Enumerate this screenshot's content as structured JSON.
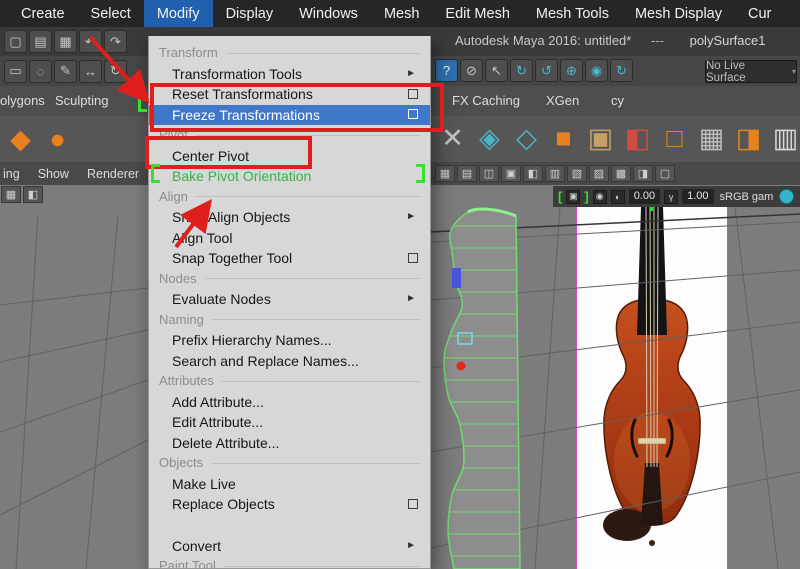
{
  "menubar": {
    "items": [
      {
        "label": "Create"
      },
      {
        "label": "Select"
      },
      {
        "label": "Modify",
        "active": true
      },
      {
        "label": "Display"
      },
      {
        "label": "Windows"
      },
      {
        "label": "Mesh"
      },
      {
        "label": "Edit Mesh"
      },
      {
        "label": "Mesh Tools"
      },
      {
        "label": "Mesh Display"
      },
      {
        "label": "Cur"
      }
    ]
  },
  "titlebar": {
    "title": "Autodesk Maya 2016: untitled*",
    "dashes": "---",
    "selection": "polySurface1"
  },
  "statusline": {
    "live_surface": "No Live Surface"
  },
  "quick_icons": [
    {
      "name": "new-scene-icon",
      "glyph": "▢"
    },
    {
      "name": "open-scene-icon",
      "glyph": "▤"
    },
    {
      "name": "save-scene-icon",
      "glyph": "▦"
    },
    {
      "name": "undo-icon",
      "glyph": "↶"
    },
    {
      "name": "redo-icon",
      "glyph": "↷"
    }
  ],
  "status_icons_left": [
    {
      "name": "select-tool-icon",
      "glyph": "▭"
    },
    {
      "name": "lasso-tool-icon",
      "glyph": "◌"
    },
    {
      "name": "paint-select-tool-icon",
      "glyph": "✎"
    },
    {
      "name": "move-tool-icon",
      "glyph": "↔"
    },
    {
      "name": "rotate-tool-icon",
      "glyph": "↻"
    }
  ],
  "status_icons_right": [
    {
      "name": "help-icon",
      "glyph": "?",
      "fg": "#e8f1fb",
      "bg": "#2f6fae"
    },
    {
      "name": "lock-selection-icon",
      "glyph": "⊘"
    },
    {
      "name": "highlight-selection-icon",
      "glyph": "↖"
    },
    {
      "name": "snap-grid-icon",
      "glyph": "↻",
      "fg": "#49b8cc"
    },
    {
      "name": "snap-curve-icon",
      "glyph": "↺",
      "fg": "#49b8cc"
    },
    {
      "name": "snap-point-icon",
      "glyph": "⊕",
      "fg": "#49b8cc"
    },
    {
      "name": "snap-plane-icon",
      "glyph": "◉",
      "fg": "#49b8cc"
    },
    {
      "name": "construction-history-icon",
      "glyph": "↻",
      "fg": "#49b8cc"
    }
  ],
  "shelf": {
    "tabs": [
      "olygons",
      "Sculpting",
      "FX Caching",
      "XGen",
      "cy"
    ]
  },
  "shelf_icons_left": [
    {
      "name": "poly-primitive-icon",
      "glyph": "◆",
      "fg": "#e8821e"
    },
    {
      "name": "poly-sphere-icon",
      "glyph": "●",
      "fg": "#e8821e"
    }
  ],
  "shelf_icons_right": [
    {
      "name": "multi-cut-icon",
      "glyph": "✕",
      "fg": "#c0c0c0"
    },
    {
      "name": "bevel-icon",
      "glyph": "◈",
      "fg": "#4ab6c8"
    },
    {
      "name": "bridge-icon",
      "glyph": "◇",
      "fg": "#4ab6c8"
    },
    {
      "name": "extrude-icon",
      "glyph": "■",
      "fg": "#e8821e"
    },
    {
      "name": "boolean-union-icon",
      "glyph": "▣",
      "fg": "#c8a06a"
    },
    {
      "name": "boolean-difference-icon",
      "glyph": "◧",
      "fg": "#d24b3f"
    },
    {
      "name": "combine-icon",
      "glyph": "□",
      "fg": "#e8821e"
    },
    {
      "name": "separate-icon",
      "glyph": "▦",
      "fg": "#bdbdbd"
    },
    {
      "name": "smooth-icon",
      "glyph": "◨",
      "fg": "#e8821e"
    },
    {
      "name": "mirror-icon",
      "glyph": "▥",
      "fg": "#d8d8d8"
    }
  ],
  "panel_toolbar": {
    "labels": [
      "ing",
      "Show",
      "Renderer"
    ]
  },
  "panel_icons": [
    {
      "name": "select-camera-icon",
      "glyph": "▦"
    },
    {
      "name": "lock-camera-icon",
      "glyph": "▤"
    },
    {
      "name": "image-plane-icon",
      "glyph": "◫"
    },
    {
      "name": "2d-pan-zoom-icon",
      "glyph": "▣"
    },
    {
      "name": "grease-pencil-icon",
      "glyph": "◧"
    },
    {
      "name": "film-gate-icon",
      "glyph": "▥"
    },
    {
      "name": "resolution-gate-icon",
      "glyph": "▧"
    },
    {
      "name": "gate-mask-icon",
      "glyph": "▨"
    },
    {
      "name": "field-chart-icon",
      "glyph": "▩"
    },
    {
      "name": "safe-action-icon",
      "glyph": "◨"
    },
    {
      "name": "safe-title-icon",
      "glyph": "▢"
    }
  ],
  "viewport_hud": {
    "exposure": "0.00",
    "gamma": "1.00",
    "colorspace": "sRGB gam"
  },
  "hud_left_icons": [
    {
      "name": "isolate-select-icon",
      "glyph": "▦"
    },
    {
      "name": "xray-icon",
      "glyph": "◧"
    }
  ],
  "modify_menu": {
    "items": [
      {
        "type": "header",
        "label": "Transform"
      },
      {
        "type": "item",
        "label": "Transformation Tools",
        "submenu": true
      },
      {
        "type": "item",
        "label": "Reset Transformations",
        "optionbox": true
      },
      {
        "type": "item",
        "label": "Freeze Transformations",
        "optionbox": true,
        "highlighted": true
      },
      {
        "type": "header",
        "label": "Pivot"
      },
      {
        "type": "item",
        "label": "Center Pivot"
      },
      {
        "type": "item",
        "label": "Bake Pivot Orientation",
        "green": true
      },
      {
        "type": "header",
        "label": "Align"
      },
      {
        "type": "item",
        "label": "Snap Align Objects",
        "submenu": true
      },
      {
        "type": "item",
        "label": "Align Tool"
      },
      {
        "type": "item",
        "label": "Snap Together Tool",
        "optionbox": true
      },
      {
        "type": "header",
        "label": "Nodes"
      },
      {
        "type": "item",
        "label": "Evaluate Nodes",
        "submenu": true
      },
      {
        "type": "header",
        "label": "Naming"
      },
      {
        "type": "item",
        "label": "Prefix Hierarchy Names..."
      },
      {
        "type": "item",
        "label": "Search and Replace Names..."
      },
      {
        "type": "header",
        "label": "Attributes"
      },
      {
        "type": "item",
        "label": "Add Attribute..."
      },
      {
        "type": "item",
        "label": "Edit Attribute..."
      },
      {
        "type": "item",
        "label": "Delete Attribute..."
      },
      {
        "type": "header",
        "label": "Objects"
      },
      {
        "type": "item",
        "label": "Make Live"
      },
      {
        "type": "item",
        "label": "Replace Objects",
        "optionbox": true
      },
      {
        "type": "gap"
      },
      {
        "type": "item",
        "label": "Convert",
        "submenu": true
      },
      {
        "type": "header",
        "label": "Paint Tool"
      }
    ]
  },
  "colors": {
    "annotation-red": "#df1f1c",
    "highlight-blue": "#3f78c8",
    "menu-active-blue": "#2060ae",
    "green-accent": "#3fae4a",
    "wireframe-green": "#35e02f",
    "shelf-orange": "#e8821e",
    "snap-teal": "#49b8cc"
  }
}
